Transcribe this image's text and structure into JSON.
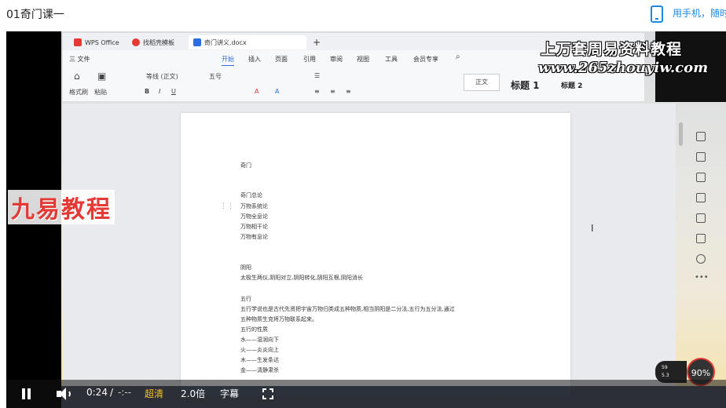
{
  "header": {
    "course_title": "01奇门课一",
    "phone_link": "用手机，随时"
  },
  "wps": {
    "tabs": [
      {
        "label": "WPS Office",
        "icon": "wps-logo-icon"
      },
      {
        "label": "找稻壳模板",
        "icon": "docer-icon"
      },
      {
        "label": "奇门讲义.docx",
        "icon": "word-doc-icon"
      }
    ],
    "menu": {
      "file": "三 文件",
      "start": "开始",
      "insert": "插入",
      "page": "页面",
      "reference": "引用",
      "review": "审阅",
      "view": "视图",
      "tools": "工具",
      "member": "会员专享"
    },
    "ribbon": {
      "format_painter": "格式刷",
      "paste": "粘贴",
      "font_name": "等线 (正文)",
      "font_size": "五号",
      "style_normal": "正文",
      "heading1": "标题 1",
      "heading2": "标题 2"
    }
  },
  "document": {
    "lines": [
      "奇门",
      "",
      "",
      "奇门总论",
      "万物系统论",
      "万物全息论",
      "万物相干论",
      "万物有息论",
      "",
      "",
      "阴阳",
      "太极生两仪,阴阳对立,阴阳转化,阴阳互根,阴阳消长",
      "",
      "五行",
      "五行学说也是古代先贤把宇宙万物归类成五种物质,相当阴阳是二分法,五行为五分法,通过",
      "五种物质生克将万物联系起来。",
      "五行的性质",
      "水——湿润向下",
      "火——炎炎向上",
      "木——生发条达",
      "金——清静肃杀"
    ]
  },
  "watermarks": {
    "top_line1": "上万套周易资料教程",
    "top_line2": "www.265zhouyiw.com",
    "left_brand": "九易教程"
  },
  "overlay": {
    "speed_percent": "90%",
    "net_up": "59",
    "net_down": "5.3"
  },
  "player": {
    "current_time": "0:24",
    "separator": "/",
    "total_time": "-:--",
    "quality": "超清",
    "speed": "2.0倍",
    "subtitle": "字幕"
  },
  "colors": {
    "accent": "#1e88e5",
    "quality": "#f5c518",
    "brand_red": "#e53935"
  }
}
